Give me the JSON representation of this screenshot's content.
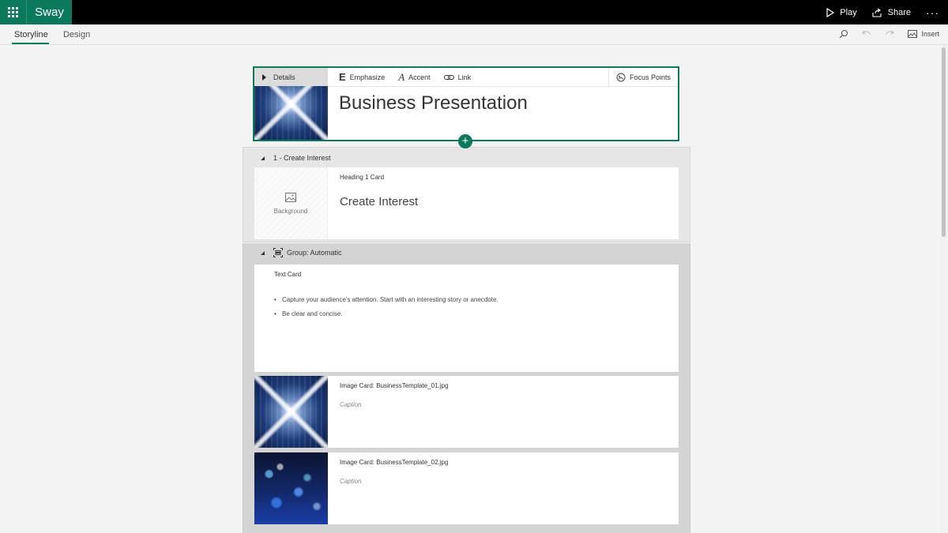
{
  "app": {
    "name": "Sway",
    "accent": "#0b7a5c"
  },
  "topbar": {
    "play": "Play",
    "share": "Share",
    "more": "···"
  },
  "tabs": {
    "storyline": "Storyline",
    "design": "Design"
  },
  "toolbar": {
    "insert": "Insert"
  },
  "title_card": {
    "details": "Details",
    "emphasize": "Emphasize",
    "accent": "Accent",
    "link": "Link",
    "focus_points": "Focus Points",
    "title": "Business Presentation"
  },
  "section1": {
    "header": "1 - Create Interest",
    "card_label": "Heading 1 Card",
    "background_label": "Background",
    "heading": "Create Interest"
  },
  "section2": {
    "header": "Group: Automatic",
    "text_card": {
      "label": "Text Card",
      "bullets": [
        "Capture your audience's attention.  Start with an interesting story or anecdote.",
        "Be clear and concise."
      ]
    },
    "image_cards": [
      {
        "label": "Image Card: BusinessTemplate_01.jpg",
        "caption": "Caption"
      },
      {
        "label": "Image Card: BusinessTemplate_02.jpg",
        "caption": "Caption"
      }
    ]
  }
}
